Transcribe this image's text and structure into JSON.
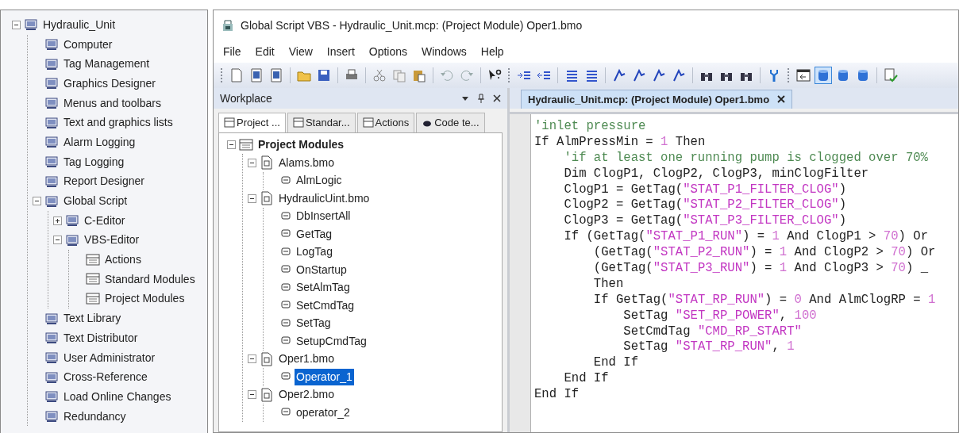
{
  "project_tree": {
    "label": "Hydraulic_Unit",
    "expanded": true,
    "children": [
      {
        "label": "Computer"
      },
      {
        "label": "Tag Management"
      },
      {
        "label": "Graphics Designer"
      },
      {
        "label": "Menus and toolbars"
      },
      {
        "label": "Text and graphics lists"
      },
      {
        "label": "Alarm Logging"
      },
      {
        "label": "Tag Logging"
      },
      {
        "label": "Report Designer"
      },
      {
        "label": "Global Script",
        "expanded": true,
        "children": [
          {
            "label": "C-Editor",
            "expanded": false
          },
          {
            "label": "VBS-Editor",
            "expanded": true,
            "children": [
              {
                "label": "Actions"
              },
              {
                "label": "Standard Modules"
              },
              {
                "label": "Project Modules"
              }
            ]
          }
        ]
      },
      {
        "label": "Text Library"
      },
      {
        "label": "Text Distributor"
      },
      {
        "label": "User Administrator"
      },
      {
        "label": "Cross-Reference"
      },
      {
        "label": "Load Online Changes"
      },
      {
        "label": "Redundancy"
      }
    ]
  },
  "window": {
    "title": "Global Script VBS - Hydraulic_Unit.mcp: (Project Module) Oper1.bmo"
  },
  "menu": [
    "File",
    "Edit",
    "View",
    "Insert",
    "Options",
    "Windows",
    "Help"
  ],
  "toolbar": [
    {
      "kind": "grip"
    },
    {
      "kind": "new",
      "pressed": false
    },
    {
      "kind": "doc",
      "pressed": false
    },
    {
      "kind": "doc",
      "pressed": false
    },
    {
      "kind": "sep"
    },
    {
      "kind": "open",
      "pressed": false
    },
    {
      "kind": "save",
      "pressed": false
    },
    {
      "kind": "sep"
    },
    {
      "kind": "print",
      "pressed": false
    },
    {
      "kind": "sep"
    },
    {
      "kind": "cut",
      "pressed": false
    },
    {
      "kind": "copy",
      "pressed": false
    },
    {
      "kind": "paste",
      "pressed": false
    },
    {
      "kind": "sep"
    },
    {
      "kind": "undo",
      "pressed": false
    },
    {
      "kind": "redo",
      "pressed": false
    },
    {
      "kind": "sep"
    },
    {
      "kind": "help",
      "pressed": false
    },
    {
      "kind": "grip"
    },
    {
      "kind": "indent",
      "pressed": false
    },
    {
      "kind": "outdent",
      "pressed": false
    },
    {
      "kind": "sep"
    },
    {
      "kind": "lines",
      "pressed": false
    },
    {
      "kind": "lines",
      "pressed": false
    },
    {
      "kind": "sep"
    },
    {
      "kind": "flag",
      "pressed": false
    },
    {
      "kind": "flag",
      "pressed": false
    },
    {
      "kind": "flag",
      "pressed": false
    },
    {
      "kind": "flag",
      "pressed": false
    },
    {
      "kind": "sep"
    },
    {
      "kind": "find",
      "pressed": false
    },
    {
      "kind": "find",
      "pressed": false
    },
    {
      "kind": "find",
      "pressed": false
    },
    {
      "kind": "sep"
    },
    {
      "kind": "wrench",
      "pressed": false
    },
    {
      "kind": "grip"
    },
    {
      "kind": "window",
      "pressed": false
    },
    {
      "kind": "database",
      "pressed": true
    },
    {
      "kind": "database",
      "pressed": false
    },
    {
      "kind": "database",
      "pressed": false
    },
    {
      "kind": "sep"
    },
    {
      "kind": "check",
      "pressed": false
    }
  ],
  "workplace": {
    "title": "Workplace",
    "tabs": [
      {
        "label": "Project ...",
        "selected": true
      },
      {
        "label": "Standar...",
        "selected": false
      },
      {
        "label": "Actions",
        "selected": false
      },
      {
        "label": "Code te...",
        "selected": false
      }
    ],
    "tree": {
      "label": "Project Modules",
      "expanded": true,
      "children": [
        {
          "label": "Alams.bmo",
          "expanded": true,
          "children": [
            {
              "label": "AlmLogic",
              "selected": false
            }
          ]
        },
        {
          "label": "HydraulicUint.bmo",
          "expanded": true,
          "children": [
            {
              "label": "DbInsertAll",
              "selected": false
            },
            {
              "label": "GetTag",
              "selected": false
            },
            {
              "label": "LogTag",
              "selected": false
            },
            {
              "label": "OnStartup",
              "selected": false
            },
            {
              "label": "SetAlmTag",
              "selected": false
            },
            {
              "label": "SetCmdTag",
              "selected": false
            },
            {
              "label": "SetTag",
              "selected": false
            },
            {
              "label": "SetupCmdTag",
              "selected": false
            }
          ]
        },
        {
          "label": "Oper1.bmo",
          "expanded": true,
          "children": [
            {
              "label": "Operator_1",
              "selected": true
            }
          ]
        },
        {
          "label": "Oper2.bmo",
          "expanded": true,
          "children": [
            {
              "label": "operator_2",
              "selected": false
            }
          ]
        }
      ]
    }
  },
  "editor": {
    "tab": {
      "label": "Hydraulic_Unit.mcp: (Project Module) Oper1.bmo",
      "selected": true
    },
    "lines": [
      [
        {
          "kind": "comment",
          "text": "'inlet pressure"
        }
      ],
      [
        {
          "kind": "code",
          "text": "If AlmPressMin = "
        },
        {
          "kind": "number",
          "text": "1"
        },
        {
          "kind": "code",
          "text": " Then"
        }
      ],
      [
        {
          "kind": "comment",
          "text": "    'if at least one running pump is clogged over 70%"
        }
      ],
      [
        {
          "kind": "code",
          "text": "    Dim ClogP1, ClogP2, ClogP3, minClogFilter"
        }
      ],
      [
        {
          "kind": "code",
          "text": "    ClogP1 = GetTag("
        },
        {
          "kind": "string",
          "text": "\"STAT_P1_FILTER_CLOG\""
        },
        {
          "kind": "code",
          "text": ")"
        }
      ],
      [
        {
          "kind": "code",
          "text": "    ClogP2 = GetTag("
        },
        {
          "kind": "string",
          "text": "\"STAT_P2_FILTER_CLOG\""
        },
        {
          "kind": "code",
          "text": ")"
        }
      ],
      [
        {
          "kind": "code",
          "text": "    ClogP3 = GetTag("
        },
        {
          "kind": "string",
          "text": "\"STAT_P3_FILTER_CLOG\""
        },
        {
          "kind": "code",
          "text": ")"
        }
      ],
      [
        {
          "kind": "code",
          "text": "    If (GetTag("
        },
        {
          "kind": "string",
          "text": "\"STAT_P1_RUN\""
        },
        {
          "kind": "code",
          "text": ") = "
        },
        {
          "kind": "number",
          "text": "1"
        },
        {
          "kind": "code",
          "text": " And ClogP1 > "
        },
        {
          "kind": "number",
          "text": "70"
        },
        {
          "kind": "code",
          "text": ") Or"
        }
      ],
      [
        {
          "kind": "code",
          "text": "        (GetTag("
        },
        {
          "kind": "string",
          "text": "\"STAT_P2_RUN\""
        },
        {
          "kind": "code",
          "text": ") = "
        },
        {
          "kind": "number",
          "text": "1"
        },
        {
          "kind": "code",
          "text": " And ClogP2 > "
        },
        {
          "kind": "number",
          "text": "70"
        },
        {
          "kind": "code",
          "text": ") Or"
        }
      ],
      [
        {
          "kind": "code",
          "text": "        (GetTag("
        },
        {
          "kind": "string",
          "text": "\"STAT_P3_RUN\""
        },
        {
          "kind": "code",
          "text": ") = "
        },
        {
          "kind": "number",
          "text": "1"
        },
        {
          "kind": "code",
          "text": " And ClogP3 > "
        },
        {
          "kind": "number",
          "text": "70"
        },
        {
          "kind": "code",
          "text": ") _"
        }
      ],
      [
        {
          "kind": "code",
          "text": "        Then"
        }
      ],
      [
        {
          "kind": "code",
          "text": "        If GetTag("
        },
        {
          "kind": "string",
          "text": "\"STAT_RP_RUN\""
        },
        {
          "kind": "code",
          "text": ") = "
        },
        {
          "kind": "number",
          "text": "0"
        },
        {
          "kind": "code",
          "text": " And AlmClogRP = "
        },
        {
          "kind": "number",
          "text": "1"
        }
      ],
      [
        {
          "kind": "code",
          "text": "            SetTag "
        },
        {
          "kind": "string",
          "text": "\"SET_RP_POWER\""
        },
        {
          "kind": "code",
          "text": ", "
        },
        {
          "kind": "number",
          "text": "100"
        }
      ],
      [
        {
          "kind": "code",
          "text": "            SetCmdTag "
        },
        {
          "kind": "string",
          "text": "\"CMD_RP_START\""
        }
      ],
      [
        {
          "kind": "code",
          "text": "            SetTag "
        },
        {
          "kind": "string",
          "text": "\"STAT_RP_RUN\""
        },
        {
          "kind": "code",
          "text": ", "
        },
        {
          "kind": "number",
          "text": "1"
        }
      ],
      [
        {
          "kind": "code",
          "text": "        End If"
        }
      ],
      [
        {
          "kind": "code",
          "text": "    End If"
        }
      ],
      [
        {
          "kind": "code",
          "text": "End If"
        }
      ]
    ]
  }
}
